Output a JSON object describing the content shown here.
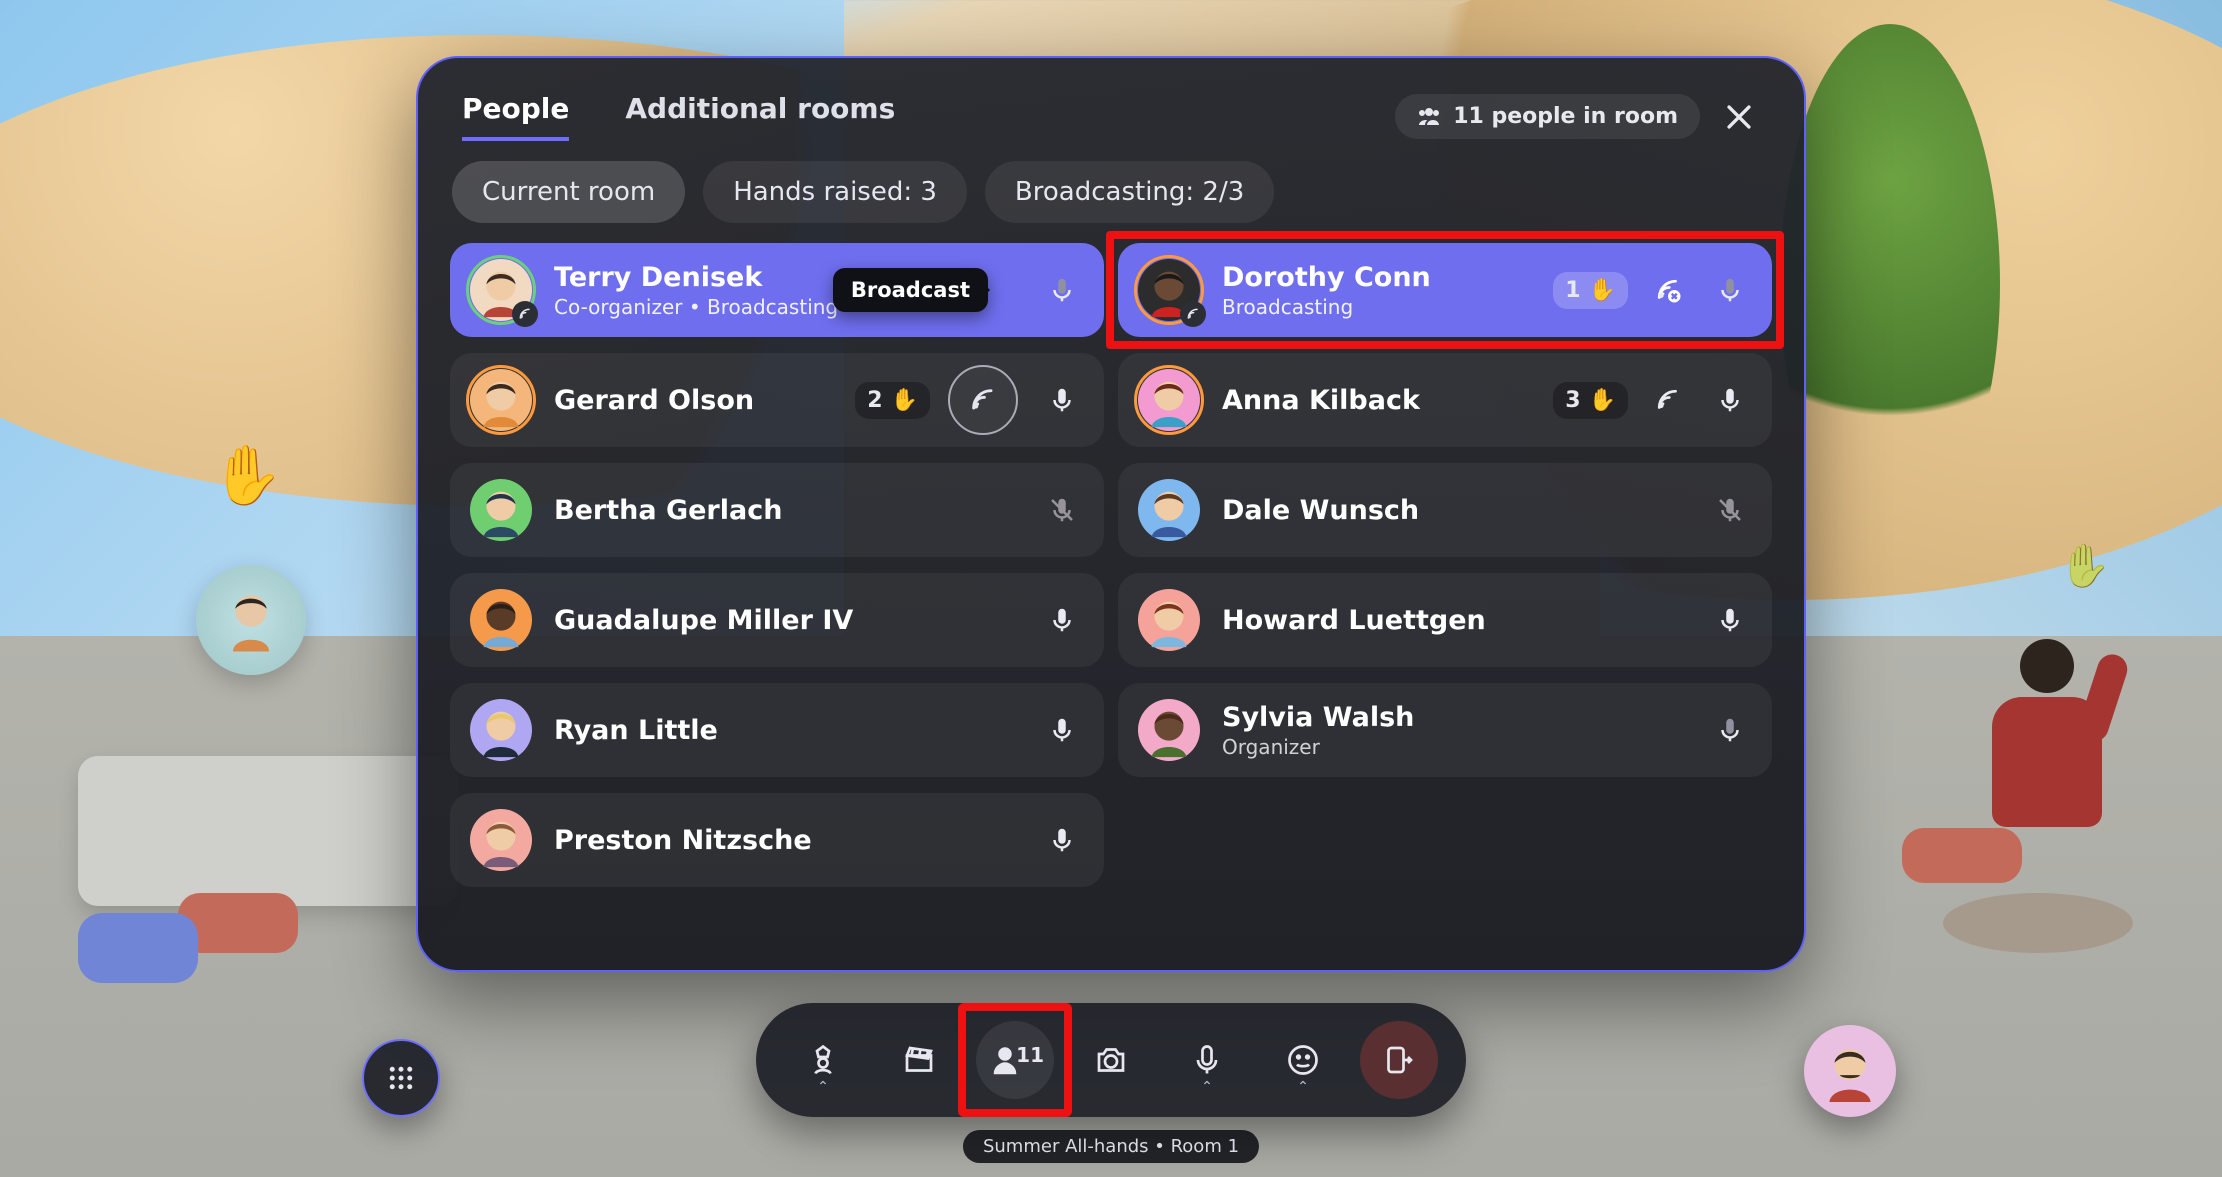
{
  "header": {
    "tabs": [
      "People",
      "Additional rooms"
    ],
    "active_tab": 0,
    "count_pill": "11 people in room"
  },
  "filters": [
    {
      "label": "Current room",
      "active": true
    },
    {
      "label": "Hands raised: 3",
      "active": false
    },
    {
      "label": "Broadcasting: 2/3",
      "active": false
    }
  ],
  "tooltip_broadcast": "Broadcast",
  "participants_left": [
    {
      "name": "Terry Denisek",
      "sub": "Co-organizer • Broadcasting",
      "primary": true,
      "mic": "on-dim",
      "hand": null,
      "broadcast_badge": true,
      "avatar": {
        "bg": "#f1d9c2",
        "hair": "#3a2b20",
        "shirt": "#b74436"
      },
      "ring": "green",
      "tooltip": true
    },
    {
      "name": "Gerard Olson",
      "sub": null,
      "primary": false,
      "mic": "on",
      "hand": "2",
      "broadcast_circle": true,
      "avatar": {
        "bg": "#f4b67a",
        "hair": "#3b2a1c",
        "shirt": "#e08a3a"
      },
      "ring": "orange"
    },
    {
      "name": "Bertha Gerlach",
      "sub": null,
      "primary": false,
      "mic": "muted",
      "hand": null,
      "avatar": {
        "bg": "#6fcf70",
        "hair": "#20344a",
        "shirt": "#2c4a63"
      }
    },
    {
      "name": "Guadalupe Miller IV",
      "sub": null,
      "primary": false,
      "mic": "on",
      "hand": null,
      "avatar": {
        "bg": "#f59a4a",
        "hair": "#2a1f16",
        "shirt": "#75a9d6",
        "skin": "#5a3b28"
      }
    },
    {
      "name": "Ryan Little",
      "sub": null,
      "primary": false,
      "mic": "on",
      "hand": null,
      "avatar": {
        "bg": "#b0a7f3",
        "hair": "#e7c96a",
        "shirt": "#1f2a3a"
      }
    },
    {
      "name": "Preston Nitzsche",
      "sub": null,
      "primary": false,
      "mic": "on",
      "hand": null,
      "avatar": {
        "bg": "#f3a9a0",
        "hair": "#8a5a3a",
        "shirt": "#7a5b7a"
      }
    }
  ],
  "participants_right": [
    {
      "name": "Dorothy Conn",
      "sub": "Broadcasting",
      "primary": true,
      "mic": "on-dim",
      "hand": "1",
      "broadcast_x": true,
      "broadcast_badge": true,
      "avatar": {
        "bg": "#2c2c2c",
        "hair": "#1a1a1a",
        "shirt": "#c22",
        "skin": "#6a4a34"
      },
      "ring": "orange"
    },
    {
      "name": "Anna Kilback",
      "sub": null,
      "primary": false,
      "mic": "on",
      "hand": "3",
      "broadcast": true,
      "avatar": {
        "bg": "#f39ad0",
        "hair": "#6a2b1a",
        "shirt": "#3aa0c7"
      },
      "ring": "orange"
    },
    {
      "name": "Dale Wunsch",
      "sub": null,
      "primary": false,
      "mic": "muted",
      "hand": null,
      "avatar": {
        "bg": "#7fb8ef",
        "hair": "#5a3b24",
        "shirt": "#3a5aa0"
      }
    },
    {
      "name": "Howard Luettgen",
      "sub": null,
      "primary": false,
      "mic": "on",
      "hand": null,
      "avatar": {
        "bg": "#f5a39a",
        "hair": "#7a341f",
        "shirt": "#7cb7e0"
      }
    },
    {
      "name": "Sylvia Walsh",
      "sub": "Organizer",
      "primary": false,
      "mic": "on-dim",
      "hand": null,
      "avatar": {
        "bg": "#f3a9c8",
        "hair": "#4a2a1a",
        "shirt": "#4a7030",
        "skin": "#6a4a34"
      }
    }
  ],
  "dock": {
    "people_count": "11"
  },
  "room_pill": "Summer All-hands • Room 1"
}
